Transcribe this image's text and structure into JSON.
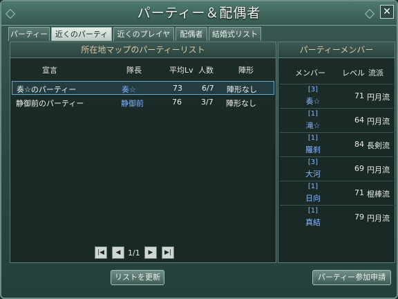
{
  "window": {
    "title": "パーティー＆配偶者",
    "close_label": "✕"
  },
  "tabs": [
    {
      "label": "パーティー"
    },
    {
      "label": "近くのパーティー"
    },
    {
      "label": "近くのプレイヤー"
    },
    {
      "label": "配偶者"
    },
    {
      "label": "結婚式リスト"
    }
  ],
  "party_list": {
    "heading": "所在地マップのパーティーリスト",
    "columns": {
      "name": "宣言",
      "leader": "隊長",
      "avg_lv": "平均Lv",
      "count": "人数",
      "formation": "陣形"
    },
    "rows": [
      {
        "name": "奏☆のパーティー",
        "leader": "奏☆",
        "avg_lv": "73",
        "count": "6/7",
        "formation": "陣形なし"
      },
      {
        "name": "静御前のパーティー",
        "leader": "静御前",
        "avg_lv": "76",
        "count": "3/7",
        "formation": "陣形なし"
      }
    ],
    "pagination": {
      "label": "1/1",
      "first_icon": "first-page-icon",
      "prev_icon": "prev-page-icon",
      "next_icon": "next-page-icon",
      "last_icon": "last-page-icon"
    }
  },
  "members_panel": {
    "heading": "パーティーメンバー",
    "columns": {
      "member": "メンバー",
      "level": "レベル",
      "style": "流派"
    },
    "members": [
      {
        "group": "[3]",
        "name": "奏☆",
        "level": "71",
        "style": "円月流"
      },
      {
        "group": "[1]",
        "name": "滝☆",
        "level": "64",
        "style": "円月流"
      },
      {
        "group": "[1]",
        "name": "羅刹",
        "level": "84",
        "style": "長剣流"
      },
      {
        "group": "[3]",
        "name": "大河",
        "level": "69",
        "style": "円月流"
      },
      {
        "group": "[1]",
        "name": "日向",
        "level": "71",
        "style": "棍棒流"
      },
      {
        "group": "[1]",
        "name": "真結",
        "level": "79",
        "style": "円月流"
      }
    ]
  },
  "buttons": {
    "refresh": "リストを更新",
    "apply": "パーティー参加申請"
  }
}
